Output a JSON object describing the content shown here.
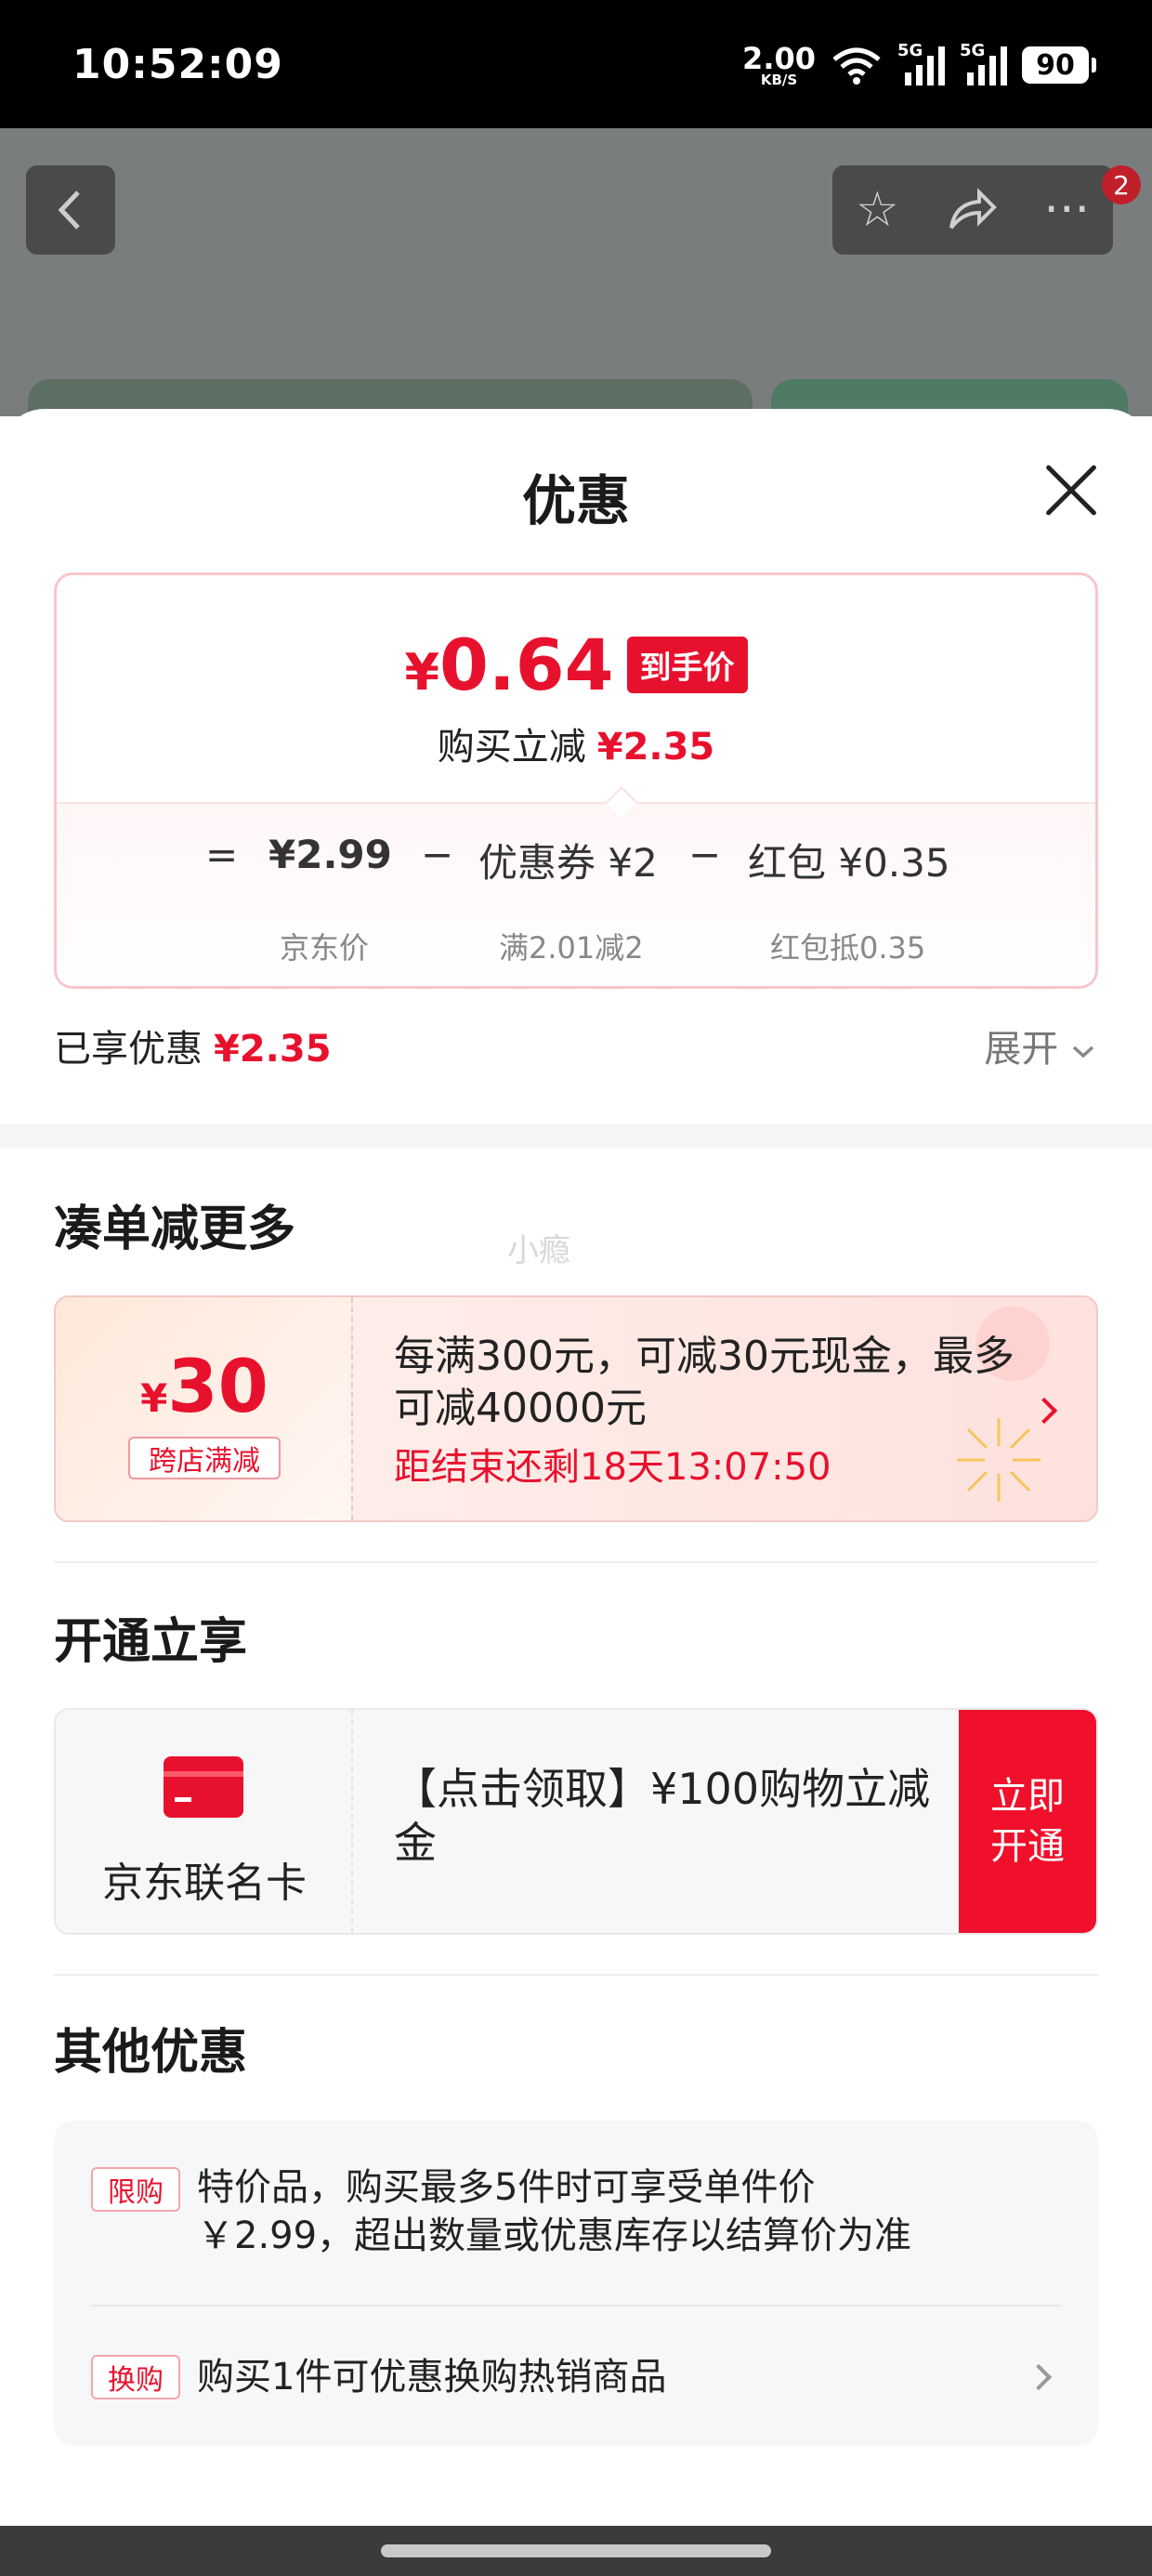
{
  "status_bar": {
    "time": "10:52:09",
    "net_speed": "2.00",
    "net_unit": "KB/S",
    "sig1": "5G",
    "sig2": "5G",
    "battery": "90"
  },
  "background_page": {
    "badge_count": "2"
  },
  "sheet": {
    "title": "优惠",
    "price_summary": {
      "currency": "¥",
      "final_price": "0.64",
      "final_tag": "到手价",
      "reduce_label": "购买立减",
      "reduce_amount": "¥2.35",
      "equals": "=",
      "minus": "−",
      "items": [
        {
          "value": "¥2.99",
          "sub": "京东价"
        },
        {
          "value": "优惠券 ¥2",
          "sub": "满2.01减2"
        },
        {
          "value": "红包 ¥0.35",
          "sub": "红包抵0.35"
        }
      ]
    },
    "enjoyed_label": "已享优惠",
    "enjoyed_amount": "¥2.35",
    "expand_label": "展开",
    "section_combine": {
      "title": "凑单减更多",
      "watermark": "小瘾",
      "promo": {
        "currency": "¥",
        "amount": "30",
        "tag": "跨店满减",
        "desc": "每满300元，可减30元现金，最多可减40000元",
        "countdown": "距结束还剩18天13:07:50"
      }
    },
    "section_open": {
      "title": "开通立享",
      "card": {
        "name": "京东联名卡",
        "desc": "【点击领取】¥100购物立减金",
        "button_line1": "立即",
        "button_line2": "开通"
      }
    },
    "section_other": {
      "title": "其他优惠",
      "items": [
        {
          "tag": "限购",
          "line1": "特价品，购买最多5件时可享受单件价",
          "line2": "￥2.99，超出数量或优惠库存以结算价为准"
        },
        {
          "tag": "换购",
          "line1": "购买1件可优惠换购热销商品"
        }
      ]
    }
  },
  "colors": {
    "accent": "#e8112d",
    "button_red": "#f0102c"
  }
}
